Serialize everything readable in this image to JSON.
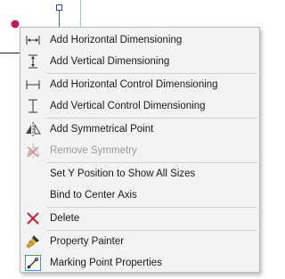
{
  "menu": {
    "items": [
      {
        "label": "Add Horizontal Dimensioning",
        "icon": "horizontal-dimension-icon",
        "enabled": true
      },
      {
        "label": "Add Vertical Dimensioning",
        "icon": "vertical-dimension-icon",
        "enabled": true
      },
      {
        "label": "Add Horizontal Control Dimensioning",
        "icon": "horizontal-control-dimension-icon",
        "enabled": true
      },
      {
        "label": "Add Vertical Control Dimensioning",
        "icon": "vertical-control-dimension-icon",
        "enabled": true
      },
      {
        "label": "Add Symmetrical Point",
        "icon": "symmetrical-point-icon",
        "enabled": true
      },
      {
        "label": "Remove Symmetry",
        "icon": "remove-symmetry-icon",
        "enabled": false
      },
      {
        "label": "Set Y Position to Show All Sizes",
        "icon": "",
        "enabled": true
      },
      {
        "label": "Bind to Center Axis",
        "icon": "",
        "enabled": true
      },
      {
        "label": "Delete",
        "icon": "delete-x-icon",
        "enabled": true
      },
      {
        "label": "Property Painter",
        "icon": "property-painter-brush-icon",
        "enabled": true
      },
      {
        "label": "Marking Point Properties",
        "icon": "marking-point-properties-icon",
        "enabled": true
      }
    ]
  },
  "colors": {
    "menu_background": "#f3f3f3",
    "delete_icon": "#c0262c",
    "marker_point": "#c2185b",
    "guide_line": "#8fc3ea",
    "properties_icon_frame": "#3a8ee6"
  }
}
